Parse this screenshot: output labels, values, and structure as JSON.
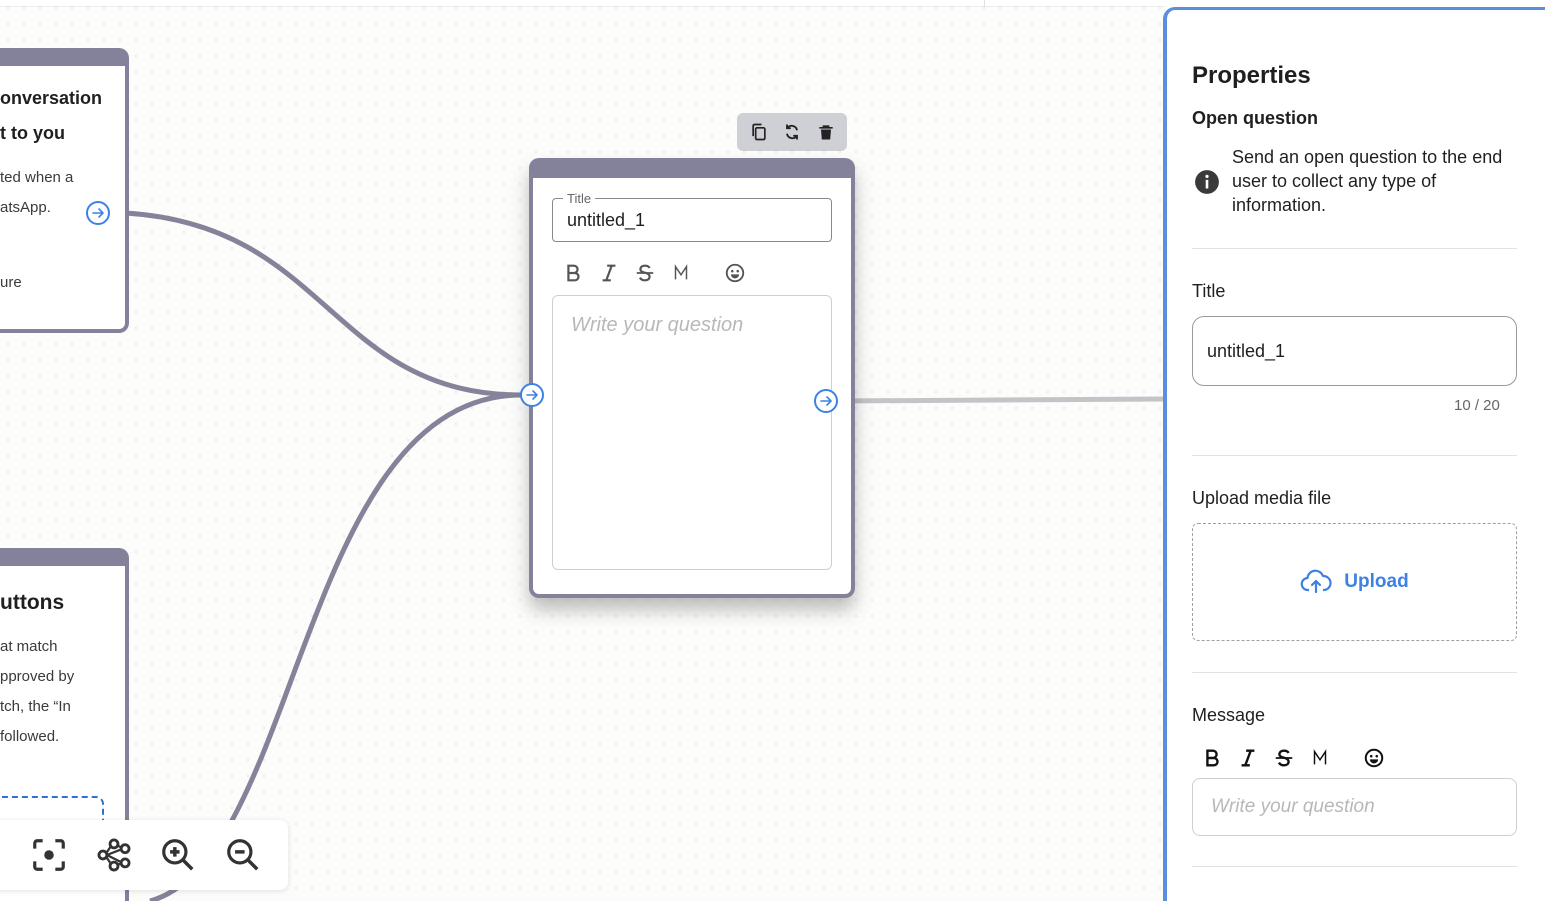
{
  "canvas": {
    "left_node_top": {
      "title_line1": "onversation",
      "title_line2": "t to you",
      "body_line1": "ted when a",
      "body_line2": "atsApp.",
      "body_line3": "ure"
    },
    "left_node_bottom": {
      "title": "uttons",
      "body_line1": "at match",
      "body_line2": "pproved by",
      "body_line3": "tch, the “In",
      "body_line4": "followed."
    },
    "question_node": {
      "title_legend": "Title",
      "title_value": "untitled_1",
      "question_placeholder": "Write your question",
      "format_icons": [
        "bold-icon",
        "italic-icon",
        "strikethrough-icon",
        "monospace-icon",
        "emoji-icon"
      ],
      "toolbar_icons": [
        "copy-icon",
        "refresh-icon",
        "delete-icon"
      ]
    },
    "zoom_controls": [
      "focus-icon",
      "share-icon",
      "zoom-in-icon",
      "zoom-out-icon"
    ],
    "colors": {
      "node_border": "#83829a",
      "handle": "#3d82e3",
      "edge": "#84839a"
    }
  },
  "properties": {
    "heading": "Properties",
    "subheading": "Open question",
    "info": "Send an open question to the end user to collect any type of information.",
    "title_label": "Title",
    "title_value": "untitled_1",
    "title_counter": "10 / 20",
    "upload_label": "Upload media file",
    "upload_button": "Upload",
    "message_label": "Message",
    "message_placeholder": "Write your question",
    "accent": "#3d82e3"
  }
}
